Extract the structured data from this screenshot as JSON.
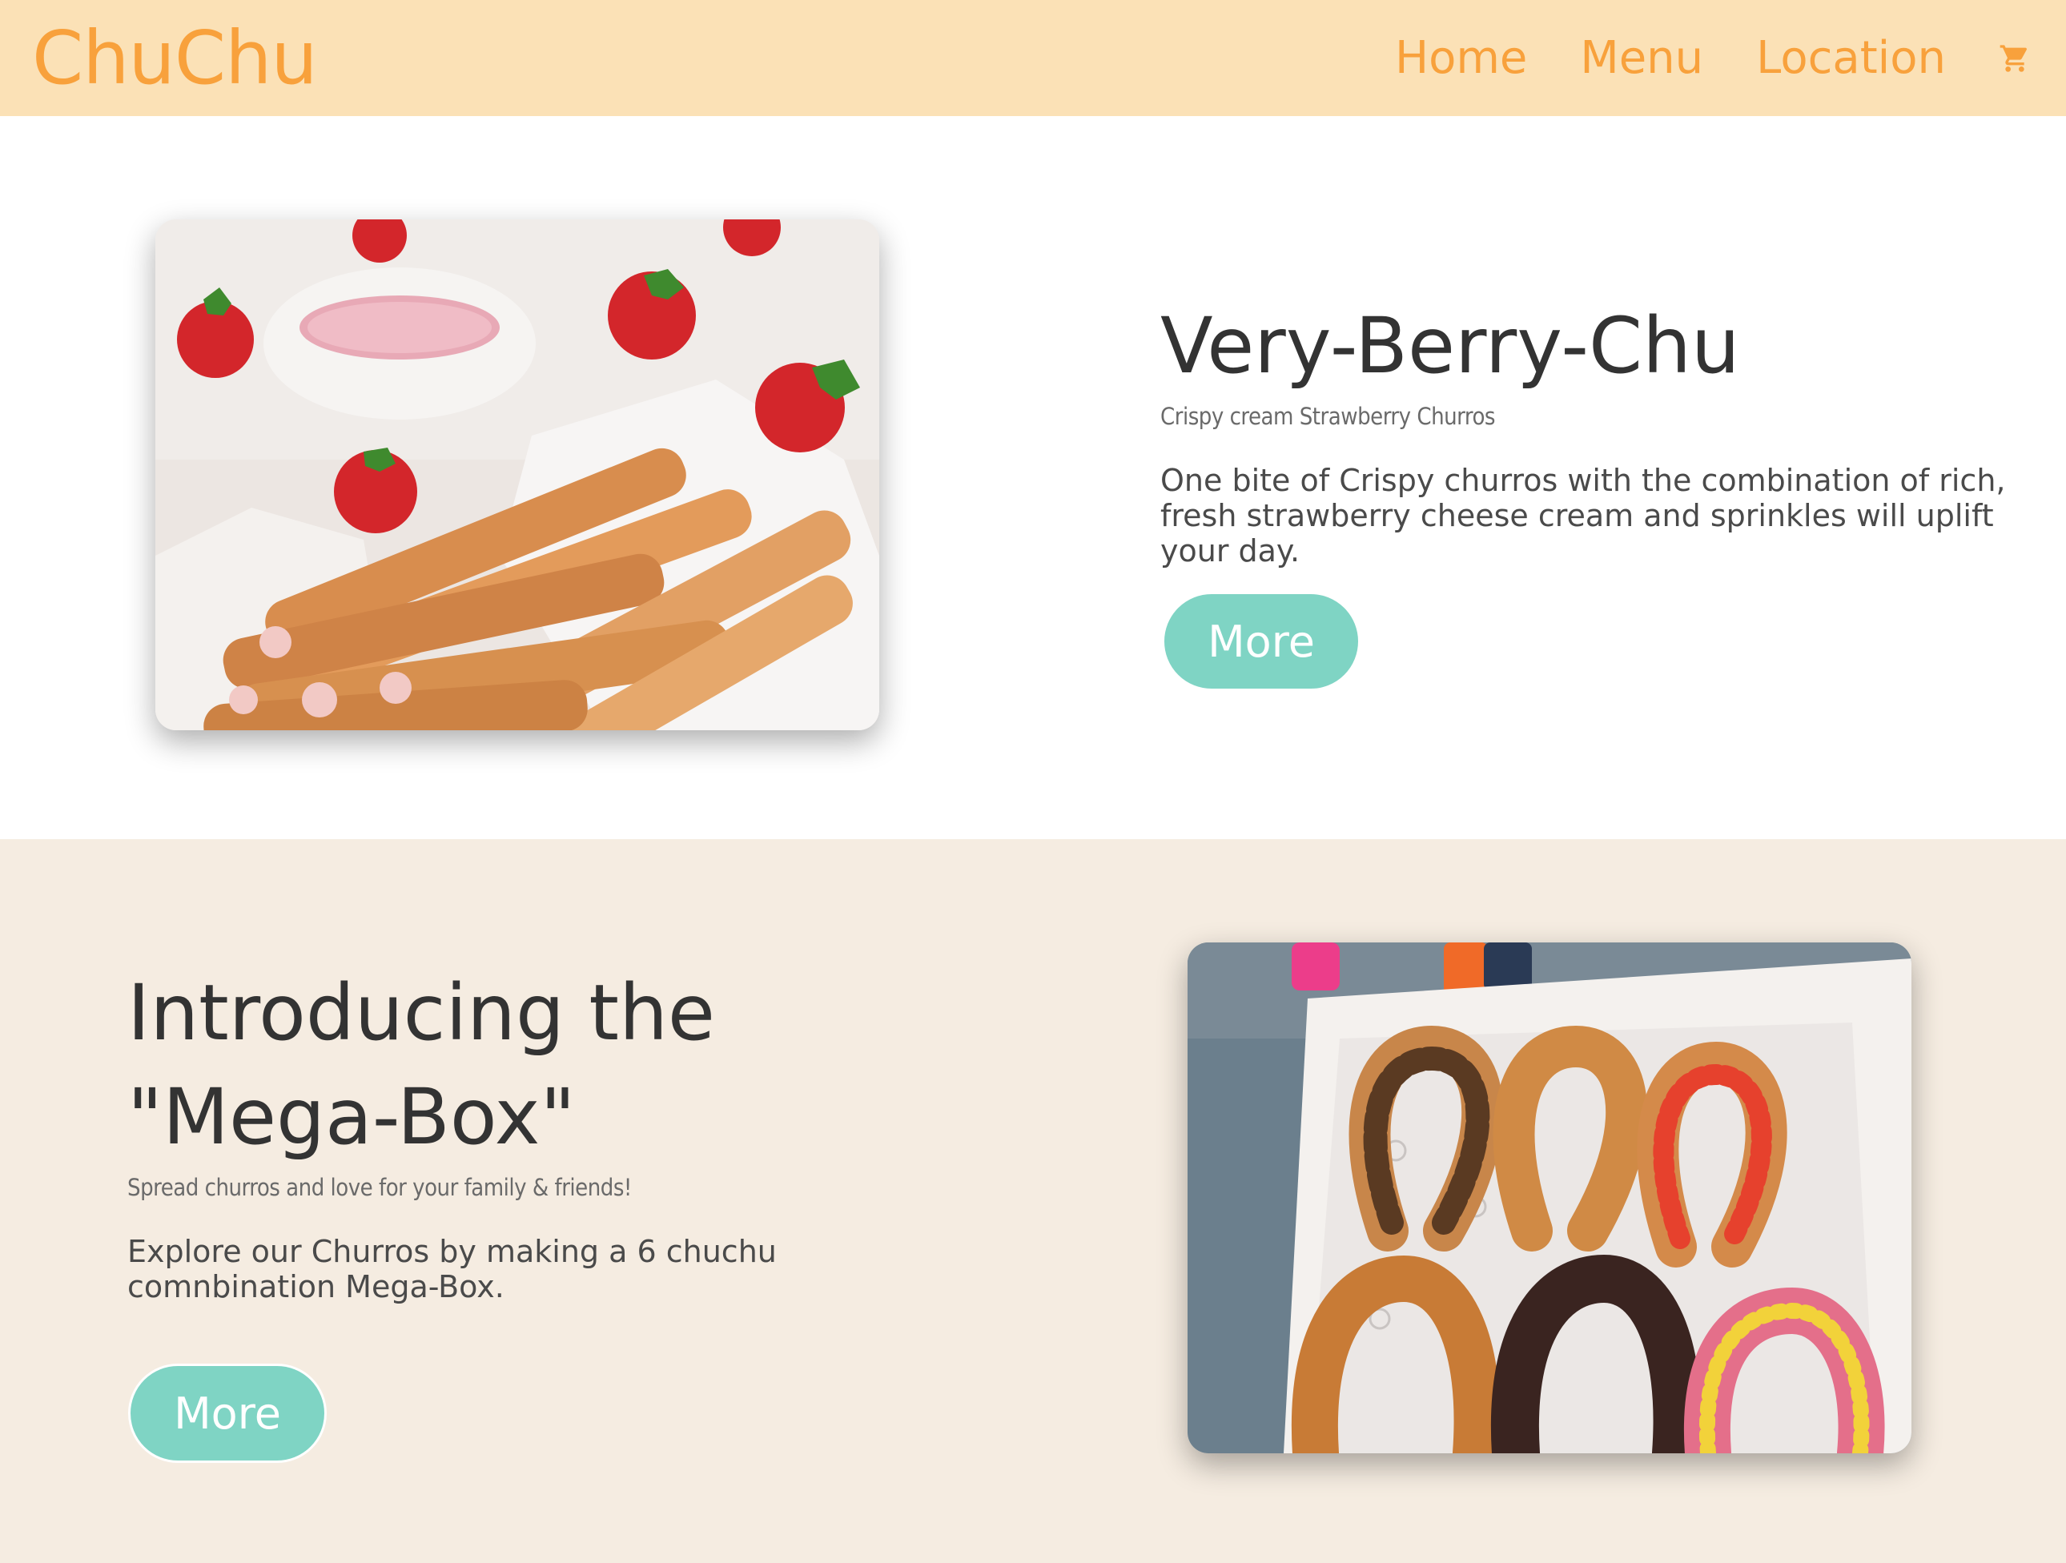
{
  "header": {
    "logo": "ChuChu",
    "nav": [
      {
        "label": "Home"
      },
      {
        "label": "Menu"
      },
      {
        "label": "Location"
      }
    ],
    "cart_icon": "shopping-cart-icon"
  },
  "colors": {
    "header_bg": "#fbe1b6",
    "brand_orange": "#f8a13c",
    "section_alt_bg": "#f5ece1",
    "button_teal": "#7fd4c4"
  },
  "feature1": {
    "title": "Very-Berry-Chu",
    "subtitle": "Crispy cream Strawberry Churros",
    "description": "One bite of Crispy churros with the combination of rich, fresh strawberry cheese cream and sprinkles will uplift your day.",
    "button_label": "More"
  },
  "feature2": {
    "title_line1": "Introducing the",
    "title_line2": "\"Mega-Box\"",
    "subtitle": "Spread churros and love for your family & friends!",
    "description": "Explore our Churros by making a 6 chuchu comnbination Mega-Box.",
    "button_label": "More"
  }
}
